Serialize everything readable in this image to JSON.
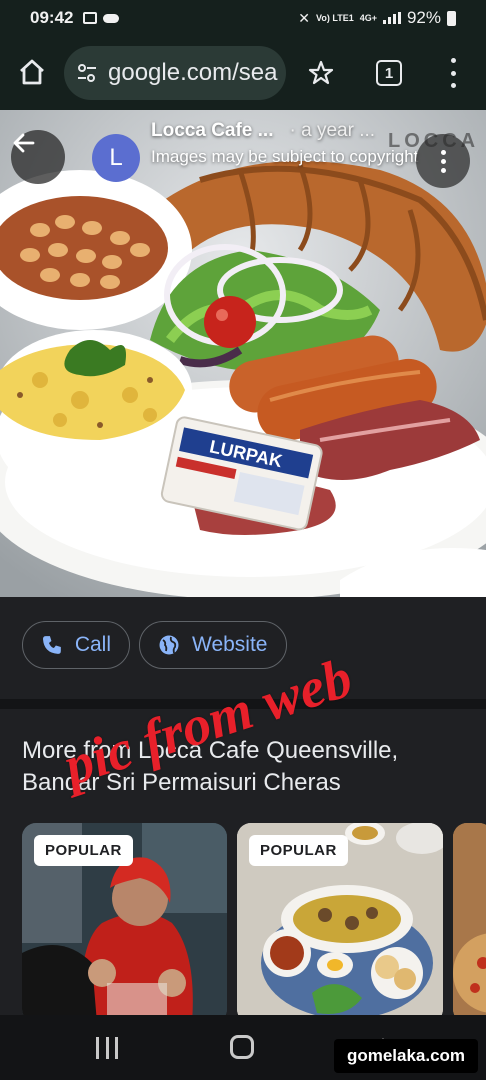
{
  "status_bar": {
    "time": "09:42",
    "network": "Vo) LTE1",
    "signal_type": "4G+",
    "battery": "92%"
  },
  "browser": {
    "url": "google.com/sea",
    "tab_count": "1"
  },
  "image_viewer": {
    "avatar_letter": "L",
    "source_title": "Locca Cafe ...",
    "time_ago": "· a year ...",
    "notice": "Images may be subject to copyright",
    "photo_logo": "LOCCA"
  },
  "actions": {
    "call_label": "Call",
    "website_label": "Website"
  },
  "more_section": {
    "heading": "More from Locca Cafe Queensville, Bandar Sri Permaisuri Cheras",
    "cards": [
      {
        "badge": "POPULAR"
      },
      {
        "badge": "POPULAR"
      }
    ]
  },
  "overlay": {
    "handwritten": "pic from web",
    "watermark": "gomelaka.com"
  },
  "icons": {
    "home": "home-icon",
    "tune": "tune-icon",
    "star": "star-icon",
    "menu": "more-vert-icon",
    "back": "arrow-back-icon",
    "phone": "phone-icon",
    "globe": "globe-icon"
  },
  "colors": {
    "link": "#8ab4f8",
    "toolbar_bg": "#15201d",
    "avatar_bg": "#5b6ed0"
  }
}
